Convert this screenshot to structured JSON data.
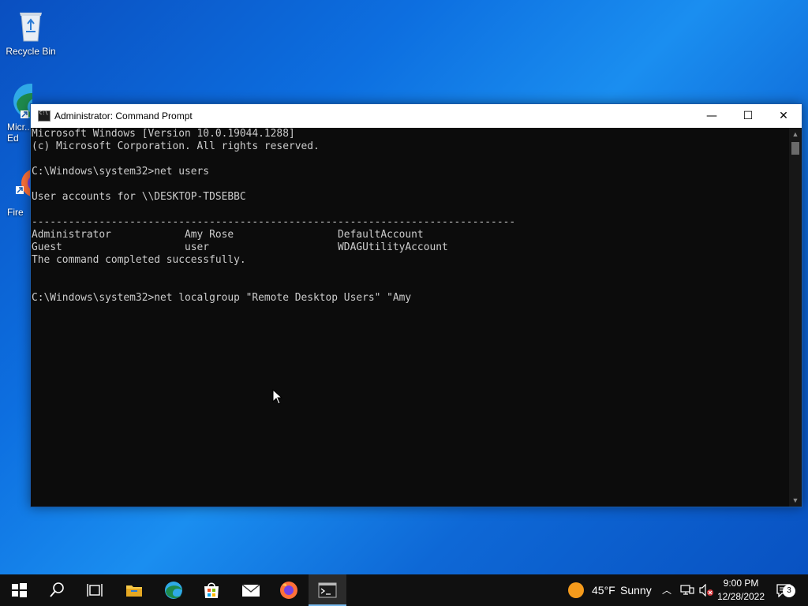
{
  "desktop": {
    "icons": [
      {
        "label": "Recycle Bin"
      },
      {
        "label": "Micr... Ed"
      },
      {
        "label": "Fire"
      }
    ]
  },
  "window": {
    "title": "Administrator: Command Prompt",
    "buttons": {
      "minimize": "—",
      "maximize": "☐",
      "close": "✕"
    },
    "lines": [
      "Microsoft Windows [Version 10.0.19044.1288]",
      "(c) Microsoft Corporation. All rights reserved.",
      "",
      "C:\\Windows\\system32>net users",
      "",
      "User accounts for \\\\DESKTOP-TDSEBBC",
      "",
      "-------------------------------------------------------------------------------",
      "Administrator            Amy Rose                 DefaultAccount",
      "Guest                    user                     WDAGUtilityAccount",
      "The command completed successfully.",
      "",
      "",
      "C:\\Windows\\system32>net localgroup \"Remote Desktop Users\" \"Amy"
    ]
  },
  "taskbar": {
    "weather": {
      "temp": "45°F",
      "condition": "Sunny"
    },
    "clock": {
      "time": "9:00 PM",
      "date": "12/28/2022"
    },
    "notifications": "3",
    "accent": "#76b9ed"
  }
}
